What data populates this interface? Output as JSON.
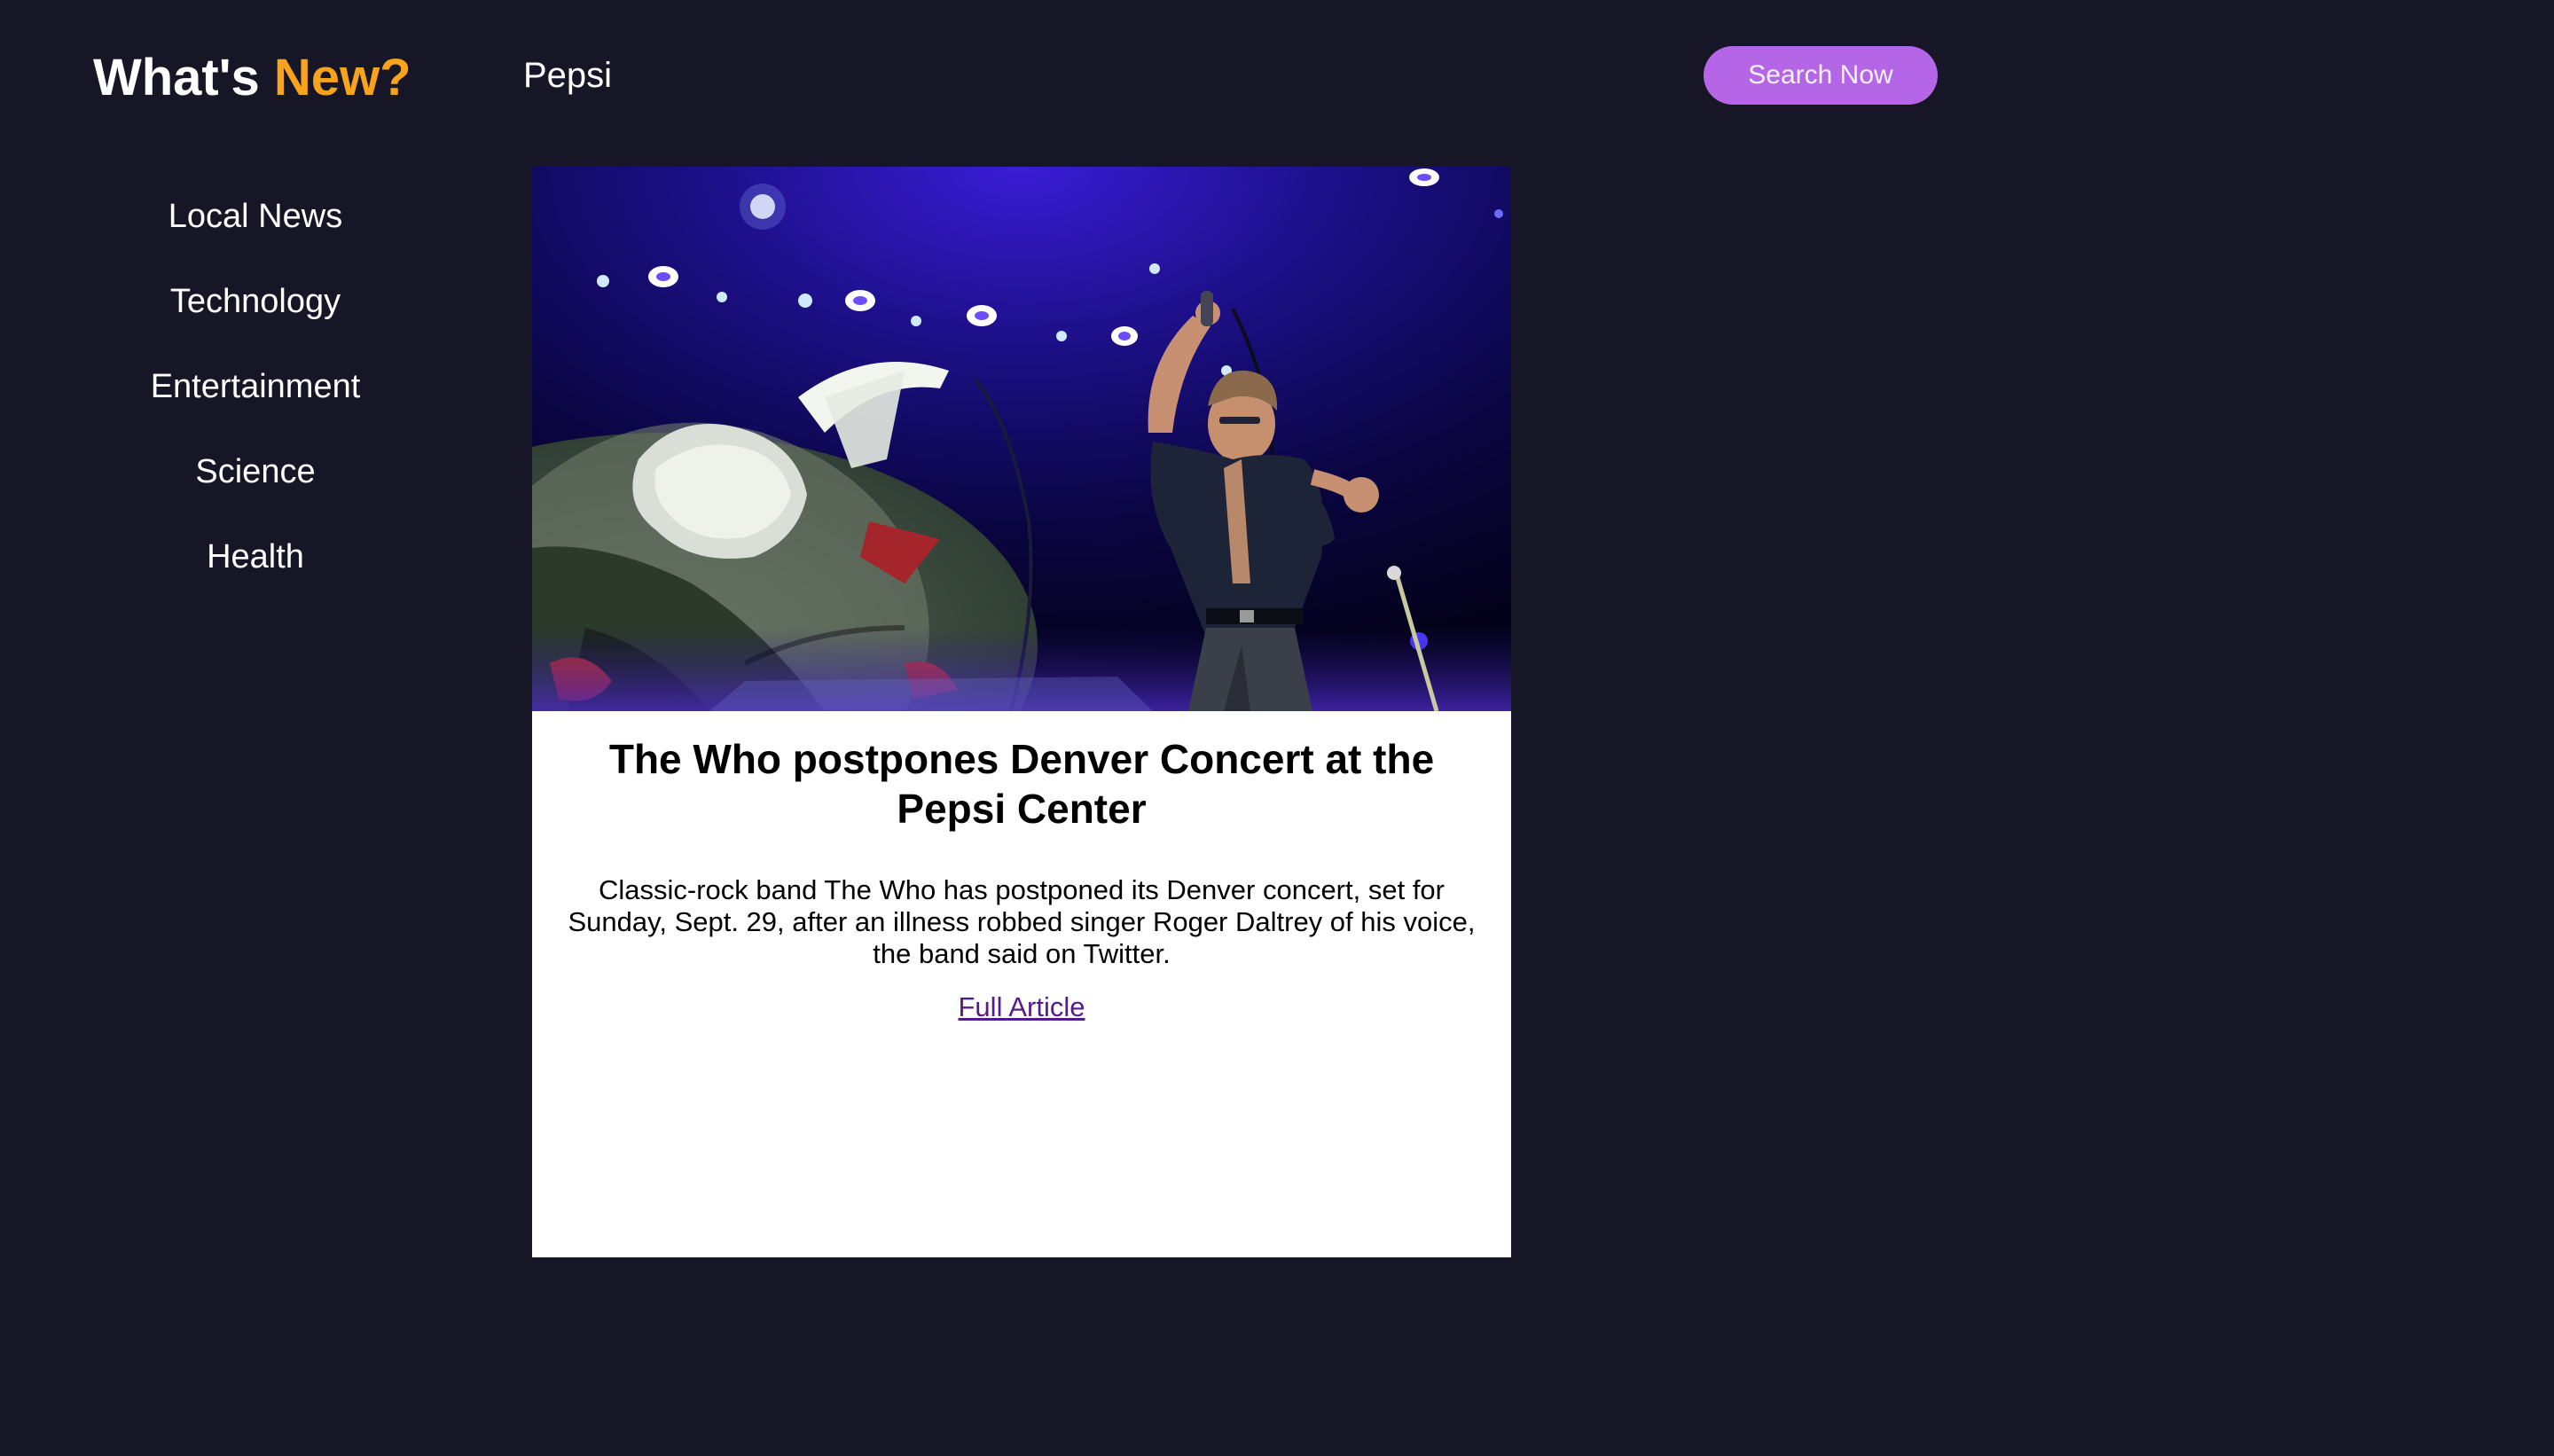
{
  "header": {
    "brand_part1": "What's",
    "brand_part2": "New?",
    "search_value": "Pepsi",
    "search_button_label": "Search Now"
  },
  "sidebar": {
    "items": [
      {
        "label": "Local News"
      },
      {
        "label": "Technology"
      },
      {
        "label": "Entertainment"
      },
      {
        "label": "Science"
      },
      {
        "label": "Health"
      }
    ]
  },
  "article": {
    "title": "The Who postpones Denver Concert at the Pepsi Center",
    "description": "Classic-rock band The Who has postponed its Denver concert, set for Sunday, Sept. 29, after an illness robbed singer Roger Daltrey of his voice, the band said on Twitter.",
    "link_label": "Full Article"
  },
  "colors": {
    "background": "#161626",
    "brand_accent": "#f7a31c",
    "button": "#b466e6",
    "card": "#ffffff",
    "link": "#551a8b"
  }
}
